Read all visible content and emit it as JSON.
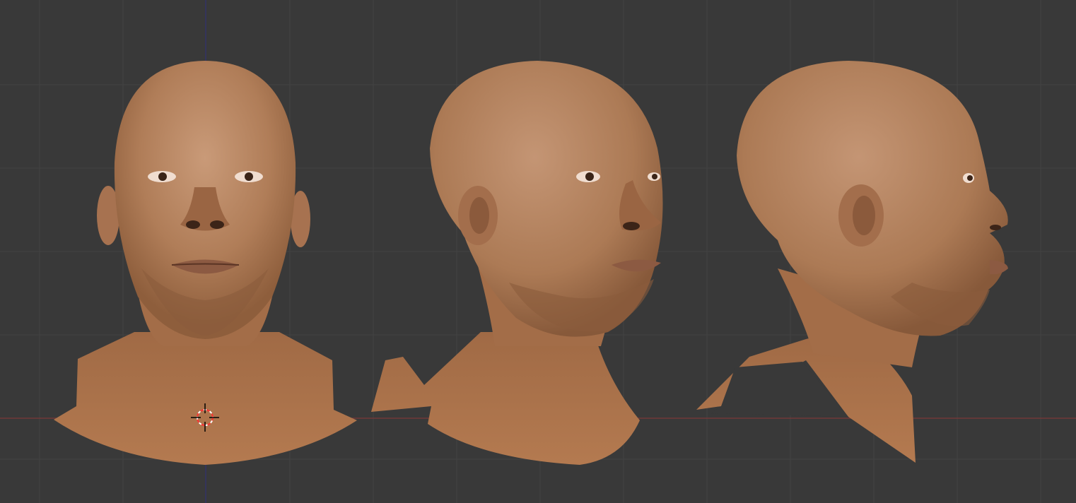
{
  "viewport": {
    "background": "#393939",
    "grid_color": "#434343",
    "x_axis_color": "#8a3636",
    "y_axis_color": "#30307a",
    "views": [
      "front",
      "three-quarter",
      "profile"
    ]
  },
  "head_model": {
    "skin_color": "#b07d58",
    "skin_shadow": "#8e5e3c",
    "skin_highlight": "#c99a78",
    "neck_color": "#a96f47"
  },
  "cursor": {
    "icon": "3d-cursor-icon",
    "ring_colors": [
      "#ff3333",
      "#ffffff"
    ]
  }
}
